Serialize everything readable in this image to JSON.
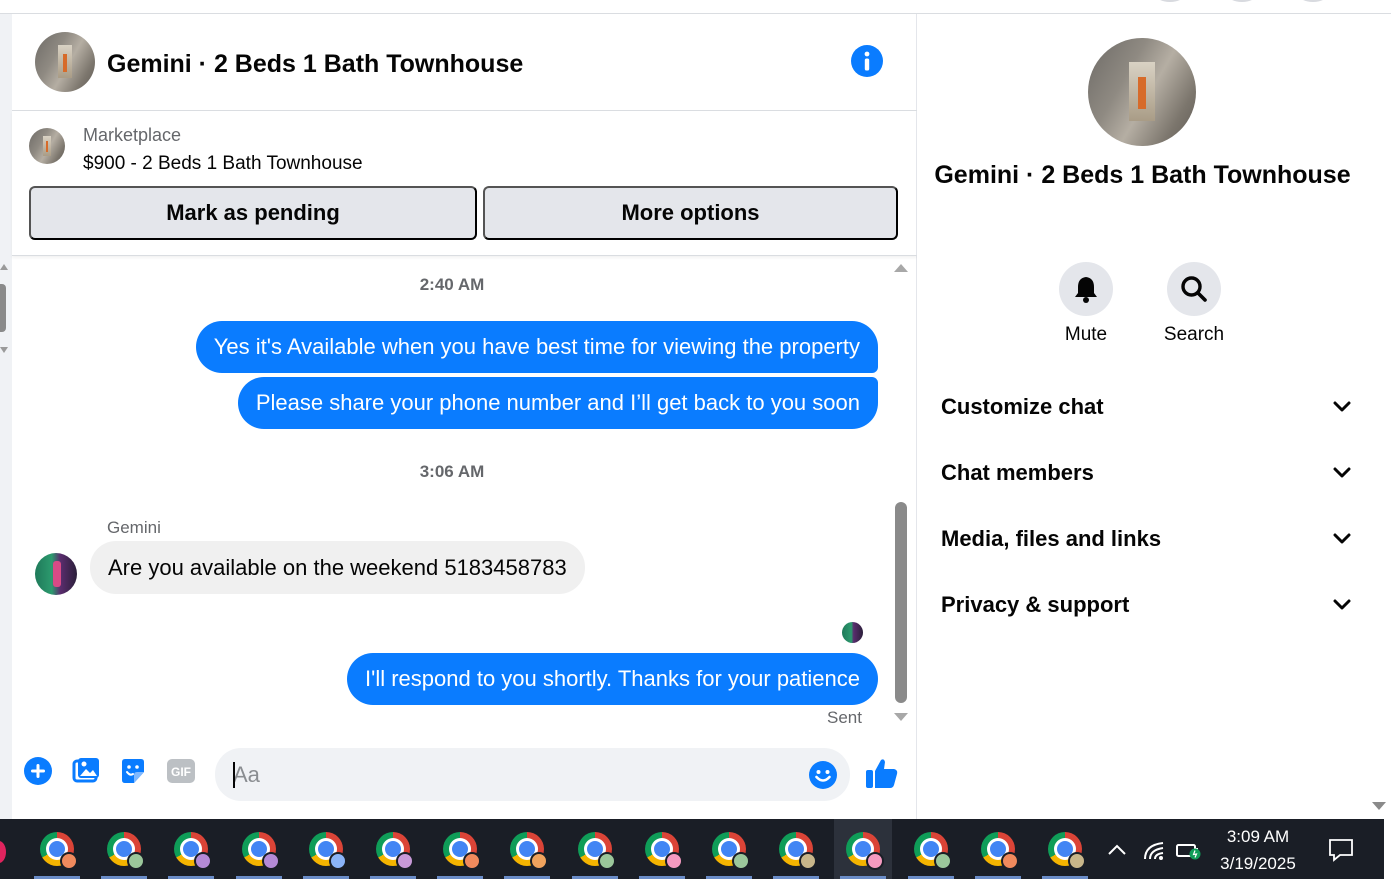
{
  "header": {
    "title": "Gemini · 2 Beds 1 Bath Townhouse",
    "info_icon": "info-icon"
  },
  "listing": {
    "label": "Marketplace",
    "price_title": "$900 - 2 Beds 1 Bath Townhouse",
    "btn_pending": "Mark as pending",
    "btn_more": "More options"
  },
  "messages": {
    "ts1": "2:40 AM",
    "out1": "Yes it's Available when you have best time for viewing the property",
    "out2": "Please share your phone number and I’ll get back to you soon",
    "ts2": "3:06 AM",
    "sender": "Gemini",
    "in1": "Are you available on the weekend 5183458783",
    "out3": "I'll respond to you shortly. Thanks for your patience",
    "status": "Sent"
  },
  "composer": {
    "placeholder": "Aa",
    "icons": [
      "plus-icon",
      "image-icon",
      "sticker-icon",
      "gif-icon",
      "emoji-icon",
      "thumbs-up-icon"
    ],
    "gif_label": "GIF"
  },
  "sidebar": {
    "title": "Gemini · 2 Beds 1 Bath Townhouse",
    "actions": [
      {
        "label": "Mute",
        "icon": "bell-icon"
      },
      {
        "label": "Search",
        "icon": "search-icon"
      }
    ],
    "sections": [
      {
        "label": "Customize chat"
      },
      {
        "label": "Chat members"
      },
      {
        "label": "Media, files and links"
      },
      {
        "label": "Privacy & support"
      }
    ]
  },
  "taskbar": {
    "time": "3:09 AM",
    "date": "3/19/2025",
    "apps": [
      {
        "icon": "chrome-icon",
        "profile_color": "#f08a5d"
      },
      {
        "icon": "chrome-icon",
        "profile_color": "#9bc79b"
      },
      {
        "icon": "chrome-icon",
        "profile_color": "#b48ad6"
      },
      {
        "icon": "chrome-icon",
        "profile_color": "#b48ad6"
      },
      {
        "icon": "chrome-icon",
        "profile_color": "#8ab4f8"
      },
      {
        "icon": "chrome-icon",
        "profile_color": "#c89ad8"
      },
      {
        "icon": "chrome-icon",
        "profile_color": "#f08a5d"
      },
      {
        "icon": "chrome-icon",
        "profile_color": "#f0a35d"
      },
      {
        "icon": "chrome-icon",
        "profile_color": "#9bc79b"
      },
      {
        "icon": "chrome-icon",
        "profile_color": "#f59ac0"
      },
      {
        "icon": "chrome-icon",
        "profile_color": "#9bc79b"
      },
      {
        "icon": "chrome-icon",
        "profile_color": "#c8b68a"
      },
      {
        "icon": "chrome-icon",
        "profile_color": "#f59ac0"
      },
      {
        "icon": "chrome-icon",
        "profile_color": "#9bc79b"
      },
      {
        "icon": "chrome-icon",
        "profile_color": "#f08a5d"
      },
      {
        "icon": "chrome-icon",
        "profile_color": "#c8b68a"
      }
    ],
    "active_index": 12
  },
  "colors": {
    "accent": "#0a7cff",
    "bubble_in": "#f0f0f0",
    "button_bg": "#e4e6eb",
    "taskbar_bg": "#1a1e26"
  }
}
